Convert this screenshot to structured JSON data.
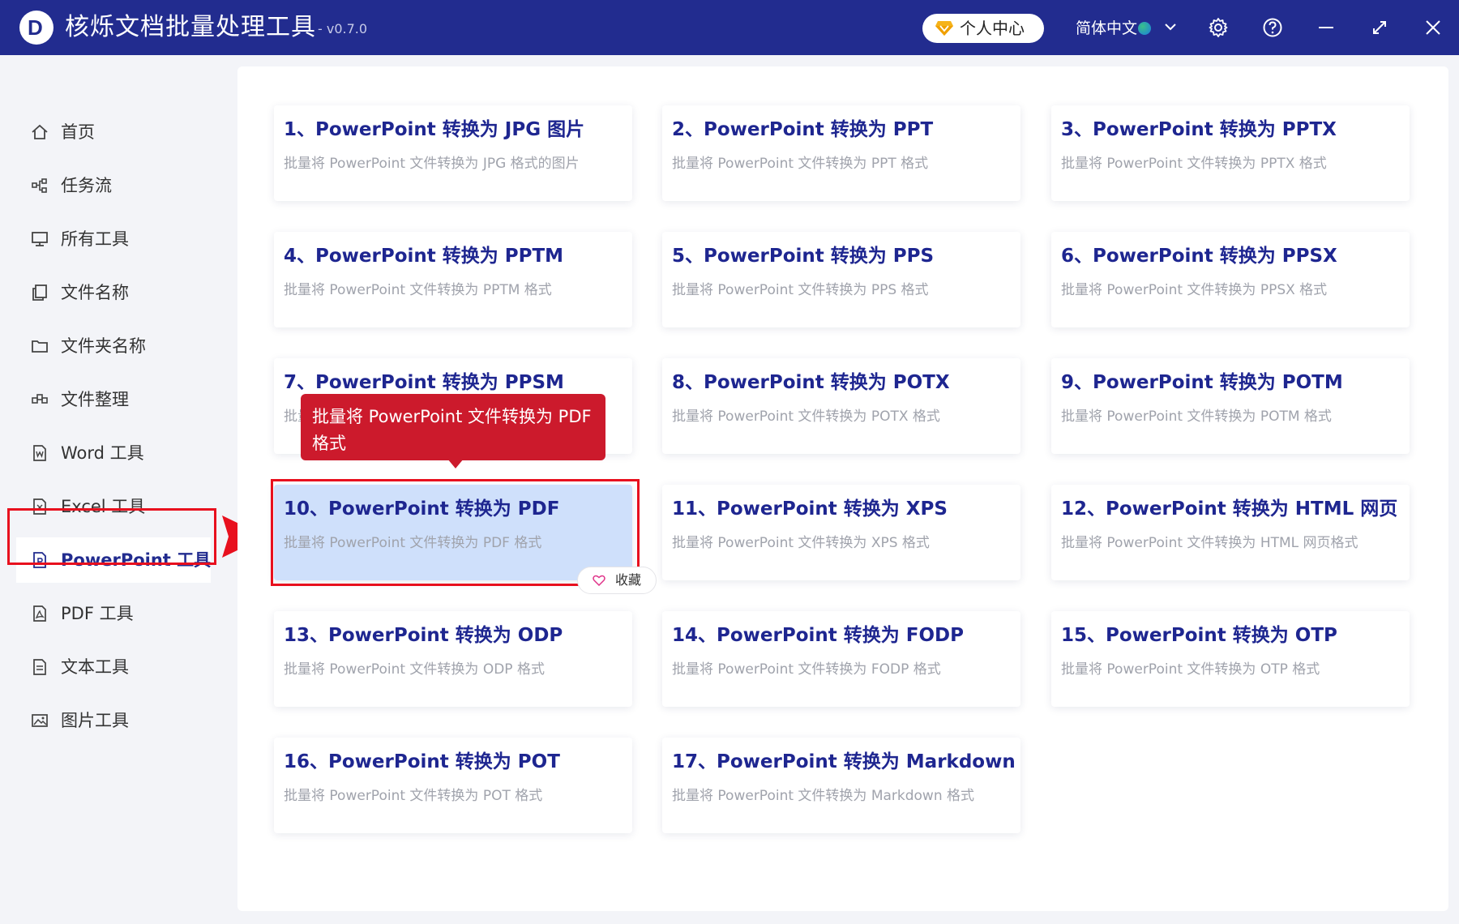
{
  "app": {
    "logo_letter": "D",
    "title": "核烁文档批量处理工具",
    "version": "- v0.7.0"
  },
  "titlebar": {
    "vip_label": "个人中心",
    "language": "简体中文",
    "icons": [
      "diamond-icon",
      "globe-icon",
      "chevron-down-icon",
      "settings-icon",
      "help-icon",
      "minimize-icon",
      "maximize-icon",
      "close-icon"
    ]
  },
  "sidebar": {
    "items": [
      {
        "label": "首页",
        "icon": "home-icon"
      },
      {
        "label": "任务流",
        "icon": "workflow-icon"
      },
      {
        "label": "所有工具",
        "icon": "monitor-icon"
      },
      {
        "label": "文件名称",
        "icon": "file-copy-icon"
      },
      {
        "label": "文件夹名称",
        "icon": "folder-icon"
      },
      {
        "label": "文件整理",
        "icon": "organize-icon"
      },
      {
        "label": "Word 工具",
        "icon": "word-file-icon"
      },
      {
        "label": "Excel 工具",
        "icon": "excel-file-icon"
      },
      {
        "label": "PowerPoint 工具",
        "icon": "ppt-file-icon",
        "active": true
      },
      {
        "label": "PDF 工具",
        "icon": "pdf-file-icon"
      },
      {
        "label": "文本工具",
        "icon": "text-file-icon"
      },
      {
        "label": "图片工具",
        "icon": "image-icon"
      }
    ]
  },
  "tools": [
    {
      "title": "1、PowerPoint 转换为 JPG 图片",
      "desc": "批量将 PowerPoint 文件转换为 JPG 格式的图片"
    },
    {
      "title": "2、PowerPoint 转换为 PPT",
      "desc": "批量将 PowerPoint 文件转换为 PPT 格式"
    },
    {
      "title": "3、PowerPoint 转换为 PPTX",
      "desc": "批量将 PowerPoint 文件转换为 PPTX 格式"
    },
    {
      "title": "4、PowerPoint 转换为 PPTM",
      "desc": "批量将 PowerPoint 文件转换为 PPTM 格式"
    },
    {
      "title": "5、PowerPoint 转换为 PPS",
      "desc": "批量将 PowerPoint 文件转换为 PPS 格式"
    },
    {
      "title": "6、PowerPoint 转换为 PPSX",
      "desc": "批量将 PowerPoint 文件转换为 PPSX 格式"
    },
    {
      "title": "7、PowerPoint 转换为 PPSM",
      "desc": "批量"
    },
    {
      "title": "8、PowerPoint 转换为 POTX",
      "desc": "批量将 PowerPoint 文件转换为 POTX 格式"
    },
    {
      "title": "9、PowerPoint 转换为 POTM",
      "desc": "批量将 PowerPoint 文件转换为 POTM 格式"
    },
    {
      "title": "10、PowerPoint 转换为 PDF",
      "desc": "批量将 PowerPoint 文件转换为 PDF 格式",
      "selected": true
    },
    {
      "title": "11、PowerPoint 转换为 XPS",
      "desc": "批量将 PowerPoint 文件转换为 XPS 格式"
    },
    {
      "title": "12、PowerPoint 转换为 HTML 网页",
      "desc": "批量将 PowerPoint 文件转换为 HTML 网页格式"
    },
    {
      "title": "13、PowerPoint 转换为 ODP",
      "desc": "批量将 PowerPoint 文件转换为 ODP 格式"
    },
    {
      "title": "14、PowerPoint 转换为 FODP",
      "desc": "批量将 PowerPoint 文件转换为 FODP 格式"
    },
    {
      "title": "15、PowerPoint 转换为 OTP",
      "desc": "批量将 PowerPoint 文件转换为 OTP 格式"
    },
    {
      "title": "16、PowerPoint 转换为 POT",
      "desc": "批量将 PowerPoint 文件转换为 POT 格式"
    },
    {
      "title": "17、PowerPoint 转换为 Markdown",
      "desc": "批量将 PowerPoint 文件转换为 Markdown 格式"
    }
  ],
  "tooltip": {
    "line1": "批量将 PowerPoint 文件转换为 PDF",
    "line2": "格式"
  },
  "favorite": {
    "label": "收藏",
    "icon": "heart-icon"
  },
  "colors": {
    "titlebar": "#222c8f",
    "accent_text": "#1e2690",
    "highlight_red": "#e8101e",
    "tooltip_red": "#cc1a2c",
    "selected_card": "#cfe0fb"
  }
}
